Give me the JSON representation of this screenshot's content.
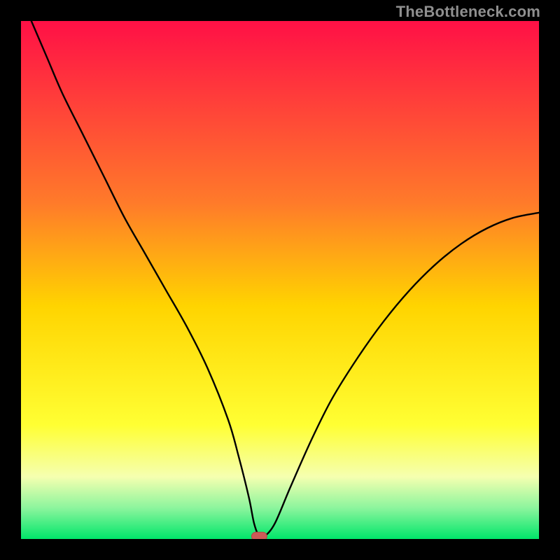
{
  "watermark": "TheBottleneck.com",
  "colors": {
    "frame": "#000000",
    "gradient_top": "#ff1046",
    "gradient_upper_mid": "#ff7a2a",
    "gradient_mid": "#ffd400",
    "gradient_yellow": "#ffff33",
    "gradient_pale": "#f5ffb0",
    "gradient_green_light": "#8cf59d",
    "gradient_green": "#00e66a",
    "curve": "#000000",
    "marker_fill": "#cc5a57",
    "marker_stroke": "#b24846"
  },
  "chart_data": {
    "type": "line",
    "title": "",
    "xlabel": "",
    "ylabel": "",
    "xlim": [
      0,
      100
    ],
    "ylim": [
      0,
      100
    ],
    "legend": false,
    "annotations": [
      "TheBottleneck.com"
    ],
    "series": [
      {
        "name": "bottleneck-curve",
        "x": [
          2,
          5,
          8,
          12,
          16,
          20,
          24,
          28,
          32,
          36,
          40,
          42,
          44,
          45,
          46,
          47,
          49,
          52,
          56,
          60,
          65,
          70,
          75,
          80,
          85,
          90,
          95,
          100
        ],
        "y": [
          100,
          93,
          86,
          78,
          70,
          62,
          55,
          48,
          41,
          33,
          23,
          16,
          8,
          3,
          0.5,
          0.5,
          3,
          10,
          19,
          27,
          35,
          42,
          48,
          53,
          57,
          60,
          62,
          63
        ]
      }
    ],
    "marker": {
      "x": 46,
      "y": 0.5,
      "shape": "pill"
    },
    "gradient_stops": [
      {
        "t": 0.0,
        "color": "#ff1046"
      },
      {
        "t": 0.35,
        "color": "#ff7a2a"
      },
      {
        "t": 0.55,
        "color": "#ffd400"
      },
      {
        "t": 0.78,
        "color": "#ffff33"
      },
      {
        "t": 0.88,
        "color": "#f5ffb0"
      },
      {
        "t": 0.94,
        "color": "#8cf59d"
      },
      {
        "t": 1.0,
        "color": "#00e66a"
      }
    ]
  }
}
